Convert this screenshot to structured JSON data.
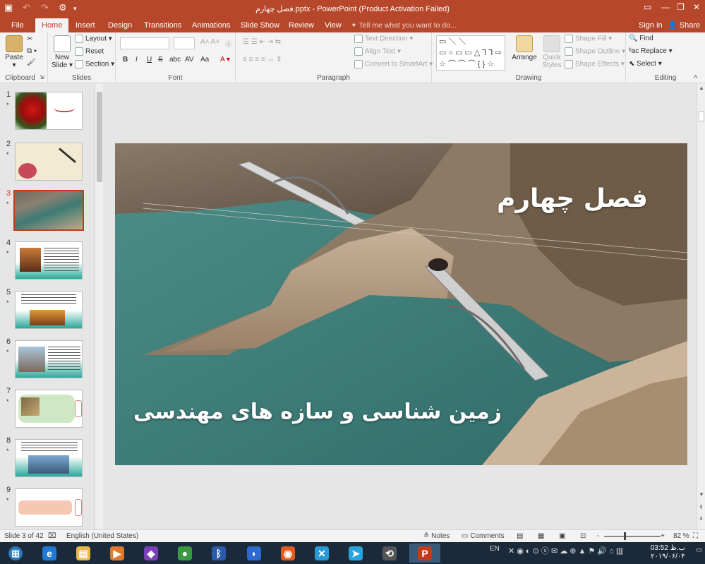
{
  "titlebar": {
    "title": "فصل چهارم.pptx - PowerPoint (Product Activation Failed)",
    "save_icon": "save-icon",
    "undo_icon": "undo-icon",
    "redo_icon": "redo-icon",
    "customize_icon": "customize-qat-icon"
  },
  "tabs": [
    "File",
    "Home",
    "Insert",
    "Design",
    "Transitions",
    "Animations",
    "Slide Show",
    "Review",
    "View"
  ],
  "active_tab": "Home",
  "tell_me": "Tell me what you want to do...",
  "account": {
    "signin": "Sign in",
    "share": "Share"
  },
  "ribbon": {
    "clipboard": {
      "label": "Clipboard",
      "paste": "Paste"
    },
    "slides": {
      "label": "Slides",
      "new_slide": "New Slide",
      "layout": "Layout",
      "reset": "Reset",
      "section": "Section"
    },
    "font": {
      "label": "Font",
      "bold": "B",
      "italic": "I",
      "underline": "U",
      "strike": "S",
      "shadow": "abc",
      "spacing": "AV",
      "case": "Aa"
    },
    "paragraph": {
      "label": "Paragraph",
      "text_direction": "Text Direction",
      "align_text": "Align Text",
      "convert_smartart": "Convert to SmartArt"
    },
    "drawing": {
      "label": "Drawing",
      "arrange": "Arrange",
      "quick_styles": "Quick Styles",
      "shape_fill": "Shape Fill",
      "shape_outline": "Shape Outline",
      "shape_effects": "Shape Effects",
      "shapes_preview": "▭＼＼▭○▭▭△⅂⅂⇨⇩▭{}☆⌒⌒⌒{}☆"
    },
    "editing": {
      "label": "Editing",
      "find": "Find",
      "replace": "Replace",
      "select": "Select"
    }
  },
  "thumbnails": [
    {
      "num": "1",
      "star": "*"
    },
    {
      "num": "2",
      "star": "*"
    },
    {
      "num": "3",
      "star": "*"
    },
    {
      "num": "4",
      "star": "*"
    },
    {
      "num": "5",
      "star": "*"
    },
    {
      "num": "6",
      "star": "*"
    },
    {
      "num": "7",
      "star": "*"
    },
    {
      "num": "8",
      "star": "*"
    },
    {
      "num": "9",
      "star": "*"
    }
  ],
  "selected_slide": 3,
  "slide": {
    "title": "فصل چهارم",
    "subtitle": "زمین شناسی و سازه های مهندسی"
  },
  "status": {
    "slide_count": "Slide 3 of 42",
    "language": "English (United States)",
    "notes": "Notes",
    "comments": "Comments",
    "zoom_minus": "-",
    "zoom_plus": "+",
    "zoom": "82 %"
  },
  "taskbar": {
    "apps": [
      {
        "name": "ie-app",
        "glyph": "e",
        "color": "#1e7ad6"
      },
      {
        "name": "file-explorer-app",
        "glyph": "▤",
        "color": "#e8b84a"
      },
      {
        "name": "media-player-app",
        "glyph": "▶",
        "color": "#e07a2b"
      },
      {
        "name": "visual-studio-app",
        "glyph": "◆",
        "color": "#7b3fb8"
      },
      {
        "name": "chrome-app",
        "glyph": "●",
        "color": "#3a9a44"
      },
      {
        "name": "bluetooth-app",
        "glyph": "ᛒ",
        "color": "#2b5aa8"
      },
      {
        "name": "defender-app",
        "glyph": "◗",
        "color": "#2c6ad1"
      },
      {
        "name": "firefox-app",
        "glyph": "◉",
        "color": "#e45a1e"
      },
      {
        "name": "tool-app",
        "glyph": "✕",
        "color": "#2a9ad6"
      },
      {
        "name": "telegram-app",
        "glyph": "➤",
        "color": "#2aa3dc"
      },
      {
        "name": "sync-app",
        "glyph": "⟲",
        "color": "#555"
      },
      {
        "name": "powerpoint-app",
        "glyph": "P",
        "color": "#c43b1c"
      }
    ],
    "lang": "EN",
    "time": "03:52 ب.ظ",
    "date": "۲۰۱۹/۰۶/۰۴"
  }
}
